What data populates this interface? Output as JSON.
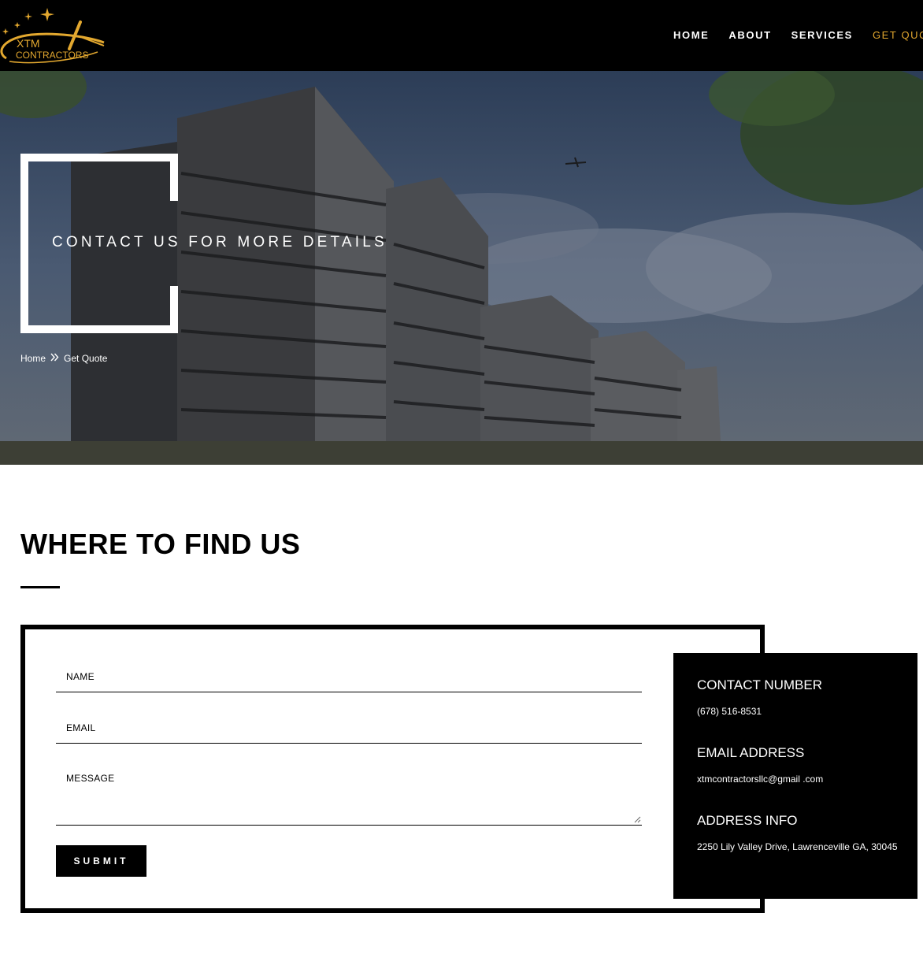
{
  "header": {
    "logo_text_line1": "XTM",
    "logo_text_line2": "CONTRACTORS",
    "nav": [
      {
        "label": "HOME"
      },
      {
        "label": "ABOUT"
      },
      {
        "label": "SERVICES"
      },
      {
        "label": "GET QUOTE"
      }
    ]
  },
  "hero": {
    "title": "CONTACT US FOR MORE DETAILS",
    "breadcrumb": {
      "home": "Home",
      "current": "Get Quote",
      "separator_icon": "double-chevron-right-icon"
    }
  },
  "section": {
    "title": "WHERE TO FIND US"
  },
  "form": {
    "name_placeholder": "NAME",
    "email_placeholder": "EMAIL",
    "message_placeholder": "MESSAGE",
    "submit_label": "SUBMIT"
  },
  "contact": {
    "phone_heading": "CONTACT NUMBER",
    "phone": "(678) 516-8531",
    "email_heading": "EMAIL ADDRESS",
    "email": "xtmcontractorsllc@gmail .com",
    "address_heading": "ADDRESS INFO",
    "address": "2250 Lily Valley Drive, Lawrenceville GA, 30045"
  },
  "colors": {
    "accent": "#e3a82f",
    "dark": "#000000",
    "light": "#ffffff"
  }
}
